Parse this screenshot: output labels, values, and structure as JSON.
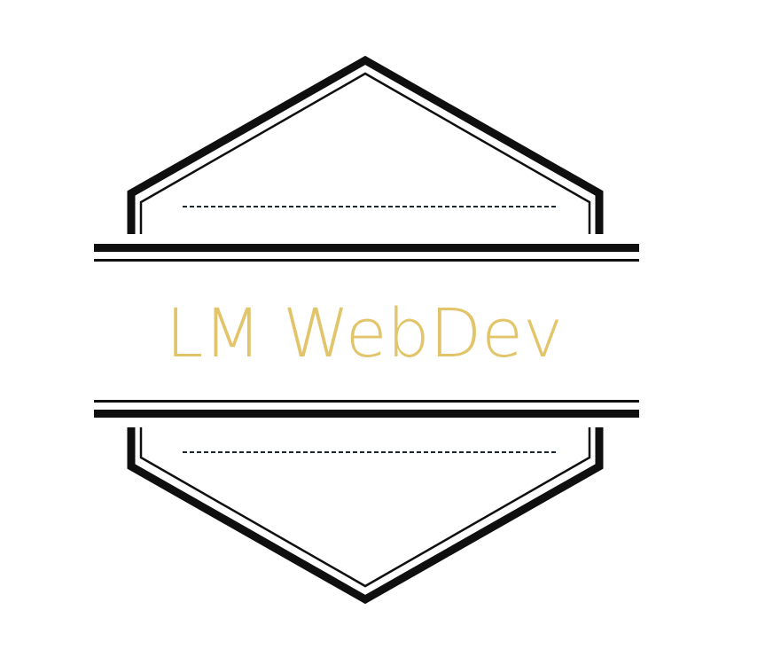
{
  "logo": {
    "text": "LM WebDev",
    "text_color": "#e2c56a",
    "line_color": "#0f0f0f",
    "dash_color": "#1b2530"
  }
}
